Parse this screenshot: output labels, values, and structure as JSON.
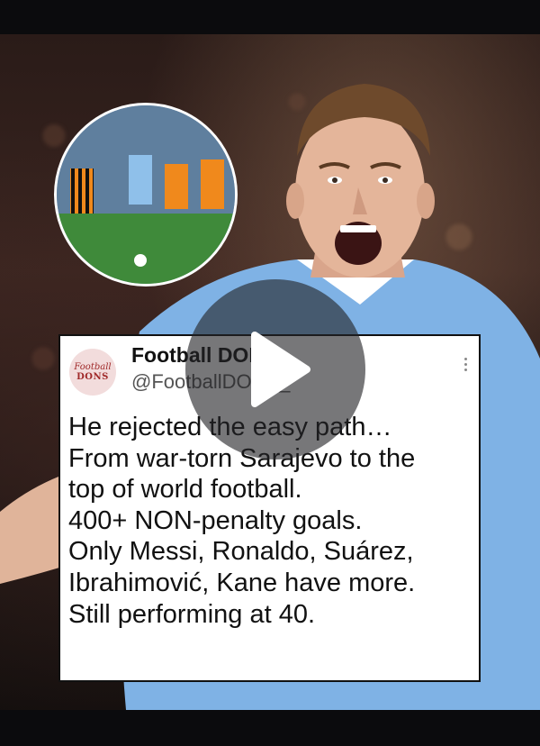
{
  "tweet": {
    "author_name": "Football DONS",
    "handle": "@FootballDONS_",
    "avatar_line1": "Football",
    "avatar_line2": "DONS",
    "lines": [
      "He rejected the easy path…",
      "From war-torn Sarajevo to the",
      "top of world football.",
      "400+ NON-penalty goals.",
      "Only Messi, Ronaldo, Suárez,",
      "Ibrahimović, Kane have more.",
      "Still performing at 40."
    ]
  },
  "colors": {
    "kit_sky_blue": "#7fb2e5",
    "card_bg": "#ffffff",
    "avatar_text": "#a02a2a"
  },
  "icons": {
    "play": "play-icon",
    "more": "more-options-icon"
  }
}
